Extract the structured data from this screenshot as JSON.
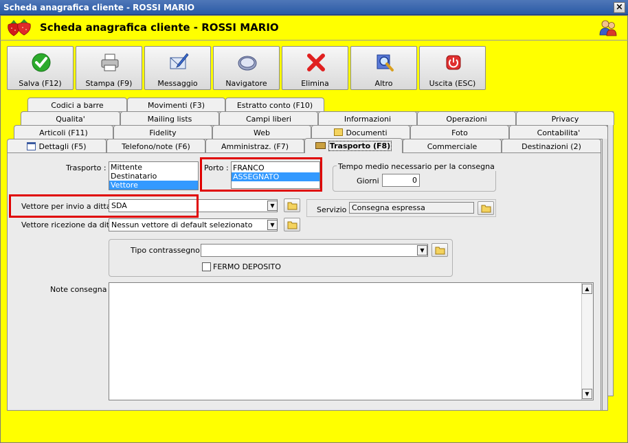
{
  "window": {
    "title": "Scheda anagrafica cliente - ROSSI MARIO",
    "close_label": "×"
  },
  "header": {
    "title": "Scheda anagrafica cliente - ROSSI MARIO"
  },
  "toolbar": {
    "save": "Salva (F12)",
    "print": "Stampa (F9)",
    "message": "Messaggio",
    "navigator": "Navigatore",
    "delete": "Elimina",
    "other": "Altro",
    "exit": "Uscita (ESC)"
  },
  "tabs": {
    "row1": [
      "Codici a barre",
      "Movimenti (F3)",
      "Estratto conto (F10)"
    ],
    "row2": [
      "Qualita'",
      "Mailing lists",
      "Campi liberi",
      "Informazioni",
      "Operazioni",
      "Privacy"
    ],
    "row3": [
      "Articoli (F11)",
      "Fidelity",
      "Web",
      "Documenti",
      "Foto",
      "Contabilita'"
    ],
    "row4": [
      "Dettagli (F5)",
      "Telefono/note (F6)",
      "Amministraz. (F7)",
      "Trasporto (F8)",
      "Commerciale",
      "Destinazioni (2)"
    ]
  },
  "form": {
    "trasporto_label": "Trasporto :",
    "trasporto_options": [
      "Mittente",
      "Destinatario",
      "Vettore"
    ],
    "trasporto_selected": "Vettore",
    "porto_label": "Porto :",
    "porto_options": [
      "FRANCO",
      "ASSEGNATO"
    ],
    "porto_selected": "ASSEGNATO",
    "tempo_group_label": "Tempo medio necessario per la consegna",
    "giorni_label": "Giorni :",
    "giorni_value": "0",
    "vettore_invio_label": "Vettore per invio a ditta :",
    "vettore_invio_value": "SDA",
    "servizio_label": "Servizio :",
    "servizio_value": "Consegna espressa",
    "vettore_ricezione_label": "Vettore ricezione da ditta",
    "vettore_ricezione_value": "Nessun vettore di default selezionato",
    "tipo_contrassegno_label": "Tipo contrassegno :",
    "tipo_contrassegno_value": "",
    "fermo_deposito_label": "FERMO DEPOSITO",
    "fermo_deposito_checked": false,
    "note_label": "Note consegna :",
    "note_value": ""
  },
  "colors": {
    "background": "#ffff00",
    "highlight": "#e00000",
    "selection": "#3399ff"
  }
}
